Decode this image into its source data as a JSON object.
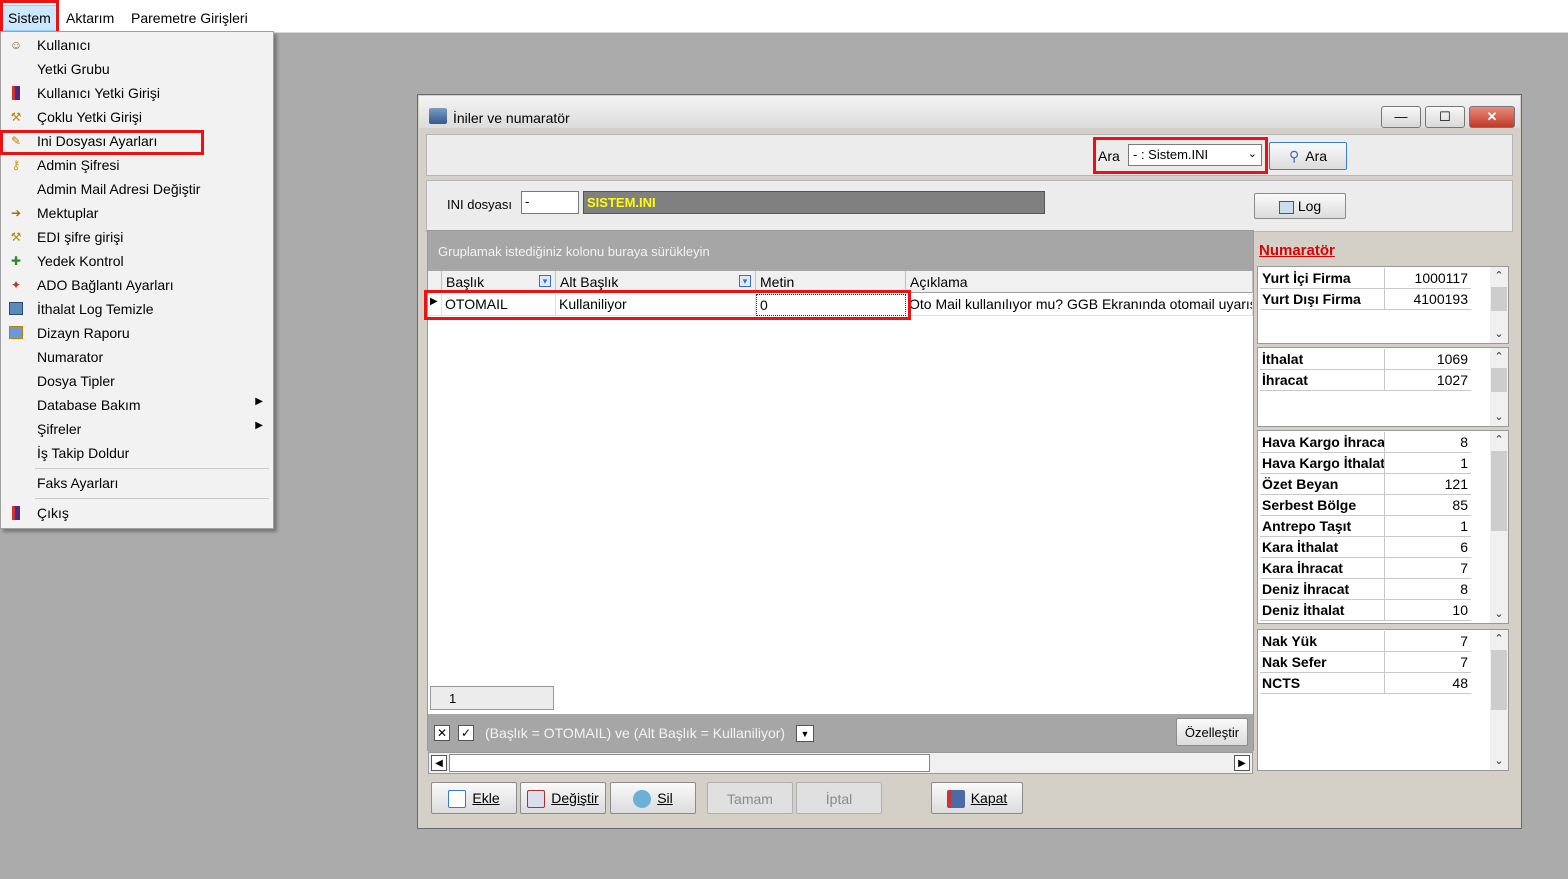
{
  "menubar": {
    "items": [
      "Sistem",
      "Aktarım",
      "Paremetre Girişleri"
    ]
  },
  "menu": {
    "items": [
      {
        "label": "Kullanıcı",
        "icon": "user-icon"
      },
      {
        "label": "Yetki Grubu",
        "icon": ""
      },
      {
        "label": "Kullanıcı Yetki Girişi",
        "icon": "book-icon"
      },
      {
        "label": "Çoklu Yetki Girişi",
        "icon": "tools-icon"
      },
      {
        "label": "Ini Dosyası  Ayarları",
        "icon": "edit-icon"
      },
      {
        "label": "Admin Şifresi",
        "icon": "key-icon"
      },
      {
        "label": "Admin Mail Adresi Değiştir",
        "icon": ""
      },
      {
        "label": "Mektuplar",
        "icon": "letter-icon"
      },
      {
        "label": "EDI şifre girişi",
        "icon": "tools-icon"
      },
      {
        "label": "Yedek Kontrol",
        "icon": "backup-icon"
      },
      {
        "label": "ADO Bağlantı Ayarları",
        "icon": "connection-icon"
      },
      {
        "label": "İthalat Log Temizle",
        "icon": "log-icon"
      },
      {
        "label": "Dizayn Raporu",
        "icon": "report-icon"
      },
      {
        "label": "Numarator",
        "icon": ""
      },
      {
        "label": "Dosya Tipler",
        "icon": ""
      },
      {
        "label": "Database Bakım",
        "icon": "",
        "submenu": true
      },
      {
        "label": "Şifreler",
        "icon": "",
        "submenu": true
      },
      {
        "label": "İş Takip Doldur",
        "icon": ""
      },
      {
        "label": "Faks Ayarları",
        "icon": ""
      },
      {
        "label": "Çıkış",
        "icon": "exit-icon"
      }
    ]
  },
  "window": {
    "title": "İniler ve numaratör",
    "min": "—",
    "max": "☐",
    "close": "✕"
  },
  "search": {
    "label": "Ara",
    "selected": "- : Sistem.INI",
    "button": "Ara"
  },
  "ini": {
    "label": "INI dosyası",
    "code": "-",
    "name": "SISTEM.INI",
    "log_button": "Log"
  },
  "grid": {
    "group_hint": "Gruplamak istediğiniz kolonu buraya sürükleyin",
    "columns": [
      "Başlık",
      "Alt Başlık",
      "Metin",
      "Açıklama"
    ],
    "rows": [
      {
        "baslik": "OTOMAIL",
        "alt_baslik": "Kullaniliyor",
        "metin": "0",
        "aciklama": "Oto Mail kullanılıyor mu? GGB Ekranında otomail uyarısı"
      }
    ],
    "footer_value": "1",
    "filter_text": "(Başlık = OTOMAIL) ve (Alt Başlık = Kullaniliyor)",
    "customize_button": "Özelleştir"
  },
  "buttons": {
    "ekle": "Ekle",
    "degistir": "Değiştir",
    "sil": "Sil",
    "tamam": "Tamam",
    "iptal": "İptal",
    "kapat": "Kapat"
  },
  "numarator": {
    "title": "Numaratör",
    "group1": [
      {
        "k": "Yurt İçi Firma",
        "v": "1000117"
      },
      {
        "k": "Yurt Dışı Firma",
        "v": "4100193"
      }
    ],
    "group2": [
      {
        "k": "İthalat",
        "v": "1069"
      },
      {
        "k": "İhracat",
        "v": "1027"
      }
    ],
    "group3": [
      {
        "k": "Hava Kargo İhracat",
        "v": "8"
      },
      {
        "k": "Hava Kargo İthalat",
        "v": "1"
      },
      {
        "k": "Özet Beyan",
        "v": "121"
      },
      {
        "k": "Serbest Bölge",
        "v": "85"
      },
      {
        "k": "Antrepo Taşıt",
        "v": "1"
      },
      {
        "k": "Kara İthalat",
        "v": "6"
      },
      {
        "k": "Kara İhracat",
        "v": "7"
      },
      {
        "k": "Deniz İhracat",
        "v": "8"
      },
      {
        "k": "Deniz İthalat",
        "v": "10"
      }
    ],
    "group4": [
      {
        "k": "Nak Yük",
        "v": "7"
      },
      {
        "k": "Nak Sefer",
        "v": "7"
      },
      {
        "k": "NCTS",
        "v": "48"
      }
    ]
  },
  "colors": {
    "highlight": "#ee1111",
    "ini_name_bg": "#808080",
    "ini_name_fg": "#ffff00",
    "numarator_title": "#e00000"
  }
}
